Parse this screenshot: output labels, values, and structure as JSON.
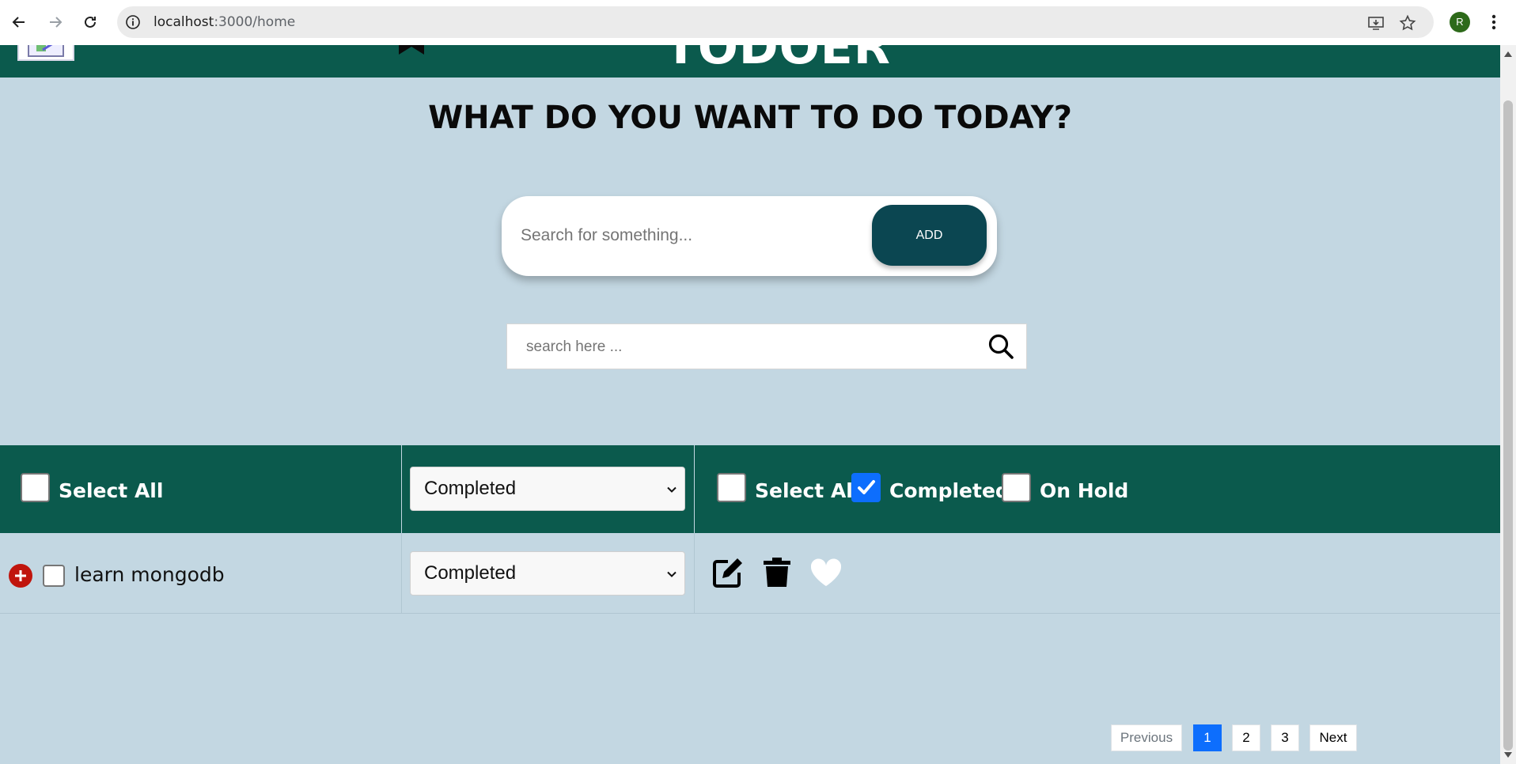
{
  "browser": {
    "url_host": "localhost",
    "url_path": ":3000/home",
    "profile_initial": "R"
  },
  "header": {
    "brand": "TODOER"
  },
  "main": {
    "heading": "WHAT DO YOU WANT TO DO TODAY?",
    "add_placeholder": "Search for something...",
    "add_label": "ADD",
    "search_placeholder": "search here ..."
  },
  "table_header": {
    "select_all": "Select All",
    "status_value": "Completed",
    "filters": [
      {
        "label": "Select All",
        "checked": false
      },
      {
        "label": "Completed",
        "checked": true
      },
      {
        "label": "On Hold",
        "checked": false
      }
    ]
  },
  "rows": [
    {
      "text": "learn mongodb",
      "status": "Completed",
      "checked": false
    }
  ],
  "pagination": {
    "previous": "Previous",
    "pages": [
      "1",
      "2",
      "3"
    ],
    "active_page": "1",
    "next": "Next"
  },
  "colors": {
    "header_bg": "#0b5a4d",
    "page_bg": "#c3d7e2",
    "add_button": "#0b4651",
    "accent_blue": "#0d6efd",
    "plus_red": "#c0150d"
  },
  "icons": {
    "back": "back-arrow-icon",
    "forward": "forward-arrow-icon",
    "reload": "reload-icon",
    "info": "info-icon",
    "install": "install-app-icon",
    "star": "star-icon",
    "menu": "kebab-menu-icon",
    "search": "magnifier-icon",
    "add_row": "plus-circle-icon",
    "edit": "edit-icon",
    "delete": "trash-icon",
    "favorite": "heart-icon"
  }
}
